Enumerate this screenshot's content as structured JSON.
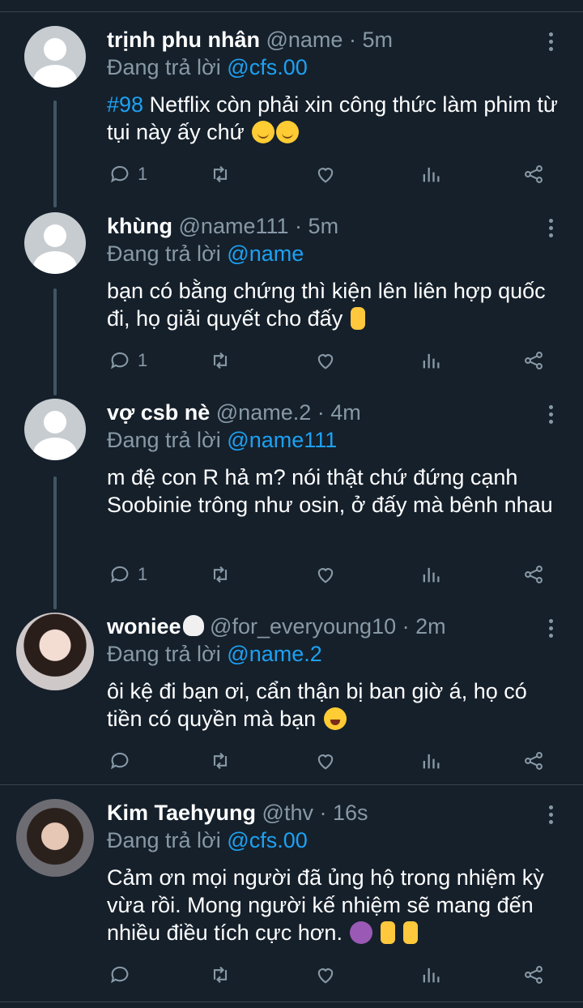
{
  "tweets": [
    {
      "name": "trịnh phu nhân",
      "handle": "@name",
      "time": "5m",
      "reply_prefix": "Đang trả lời",
      "reply_to": "@cfs.00",
      "hashtag": "#98",
      "text": "Netflix còn phải xin công thức làm phim từ tụi này ấy chứ",
      "reply_count": "1",
      "avatar": "default-avatar"
    },
    {
      "name": "khùng",
      "handle": "@name111",
      "time": "5m",
      "reply_prefix": "Đang trả lời",
      "reply_to": "@name",
      "text": "bạn có bằng chứng thì kiện lên liên hợp quốc đi, họ giải quyết cho đấy",
      "reply_count": "1",
      "avatar": "default-avatar"
    },
    {
      "name": "vợ csb nè",
      "handle": "@name.2",
      "time": "4m",
      "reply_prefix": "Đang trả lời",
      "reply_to": "@name111",
      "text": "m đệ con R hả m? nói thật chứ đứng cạnh Soobinie trông như osin, ở đấy mà bênh nhau",
      "reply_count": "1",
      "avatar": "default-avatar"
    },
    {
      "name": "woniee",
      "handle": "@for_everyoung10",
      "time": "2m",
      "reply_prefix": "Đang trả lời",
      "reply_to": "@name.2",
      "text": "ôi kệ đi bạn ơi, cẩn thận bị ban giờ á, họ có tiền có quyền mà bạn",
      "reply_count": "",
      "avatar": "photo-avatar"
    },
    {
      "name": "Kim Taehyung",
      "handle": "@thv",
      "time": "16s",
      "reply_prefix": "Đang trả lời",
      "reply_to": "@cfs.00",
      "text": "Cảm ơn mọi người đã ủng hộ trong nhiệm kỳ vừa rồi. Mong người kế nhiệm sẽ mang đến nhiều điều tích cực hơn.",
      "reply_count": "",
      "avatar": "photo-avatar"
    }
  ],
  "separator": "·",
  "colors": {
    "background": "#15202b",
    "accent": "#1da1f2",
    "muted": "#8899a6",
    "divider": "#38444d"
  },
  "icons": [
    "reply-icon",
    "retweet-icon",
    "like-icon",
    "analytics-icon",
    "share-icon",
    "more-icon"
  ]
}
